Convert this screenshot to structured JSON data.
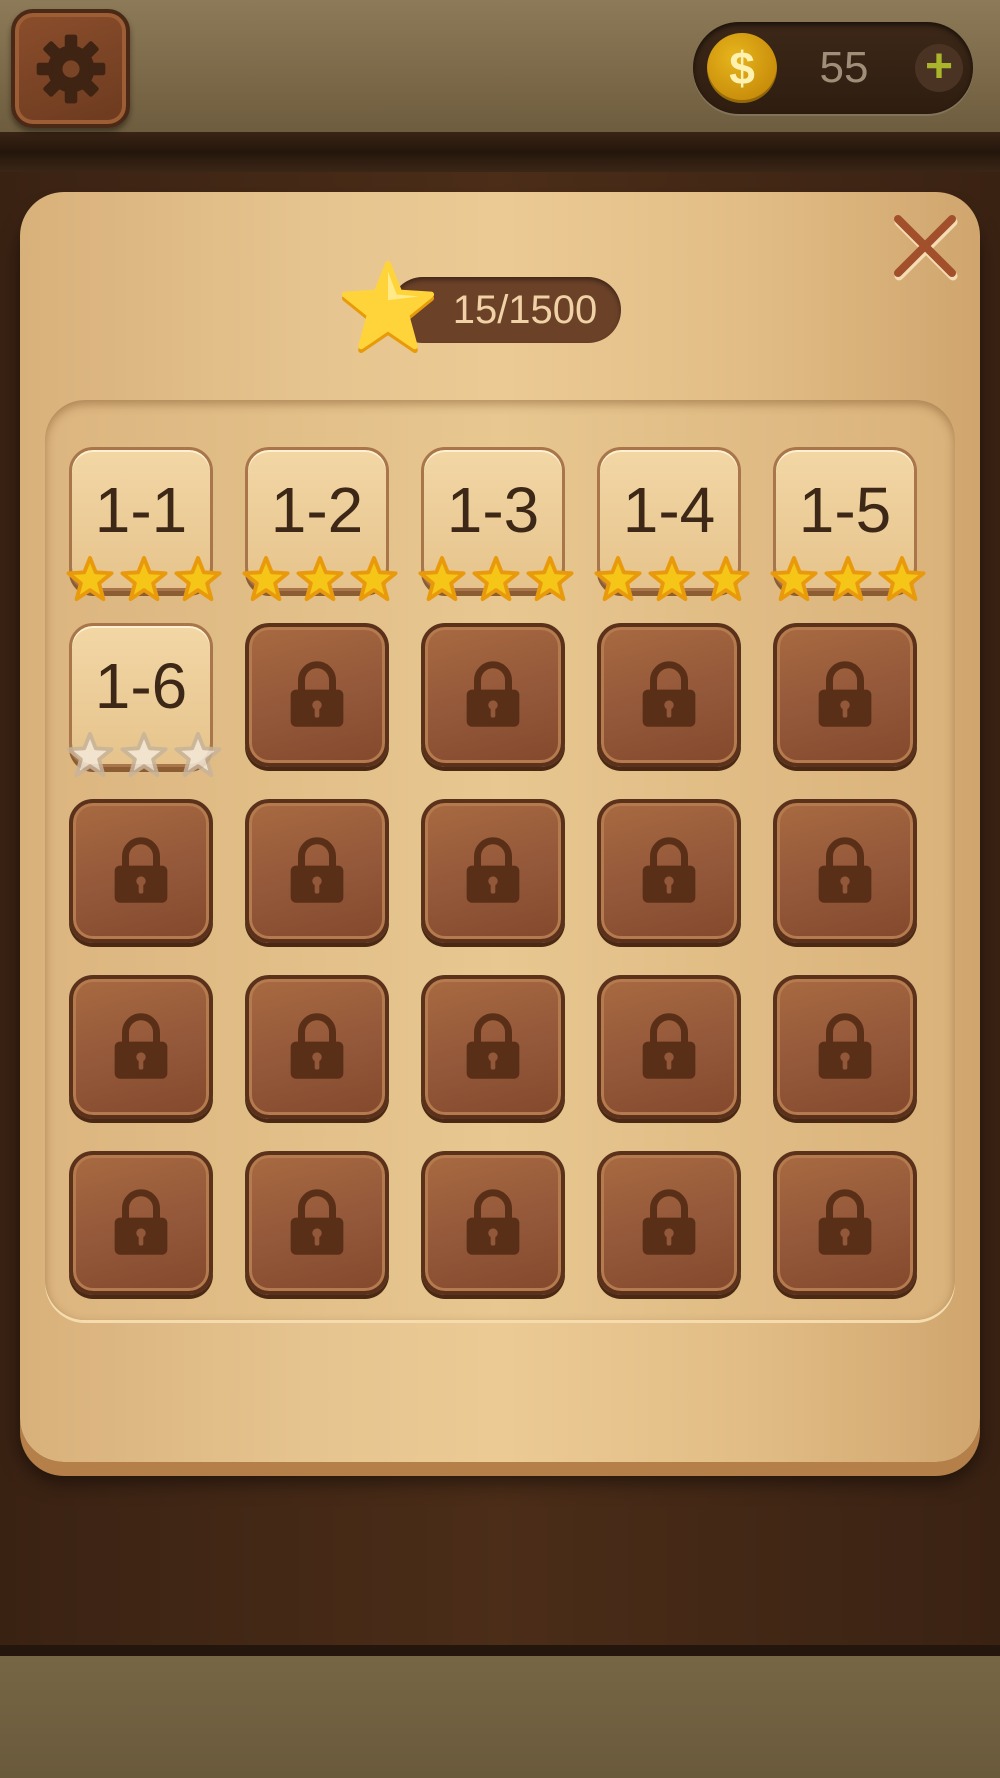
{
  "header": {
    "coins": "55",
    "coin_symbol": "$",
    "plus": "+"
  },
  "level_panel": {
    "star_progress": "15/1500",
    "levels": [
      {
        "label": "1-1",
        "locked": false,
        "stars": 3
      },
      {
        "label": "1-2",
        "locked": false,
        "stars": 3
      },
      {
        "label": "1-3",
        "locked": false,
        "stars": 3
      },
      {
        "label": "1-4",
        "locked": false,
        "stars": 3
      },
      {
        "label": "1-5",
        "locked": false,
        "stars": 3
      },
      {
        "label": "1-6",
        "locked": false,
        "stars": 0
      },
      {
        "locked": true
      },
      {
        "locked": true
      },
      {
        "locked": true
      },
      {
        "locked": true
      },
      {
        "locked": true
      },
      {
        "locked": true
      },
      {
        "locked": true
      },
      {
        "locked": true
      },
      {
        "locked": true
      },
      {
        "locked": true
      },
      {
        "locked": true
      },
      {
        "locked": true
      },
      {
        "locked": true
      },
      {
        "locked": true
      },
      {
        "locked": true
      },
      {
        "locked": true
      },
      {
        "locked": true
      },
      {
        "locked": true
      },
      {
        "locked": true
      }
    ]
  },
  "icons": {
    "settings": "gear-icon",
    "close": "close-icon",
    "locked_tile": "lock-icon",
    "star": "star-icon"
  },
  "colors": {
    "star_gold": "#f5c518",
    "star_empty": "#f3e9da",
    "locked_tile": "#93573a",
    "unlocked_tile": "#ecca94"
  }
}
